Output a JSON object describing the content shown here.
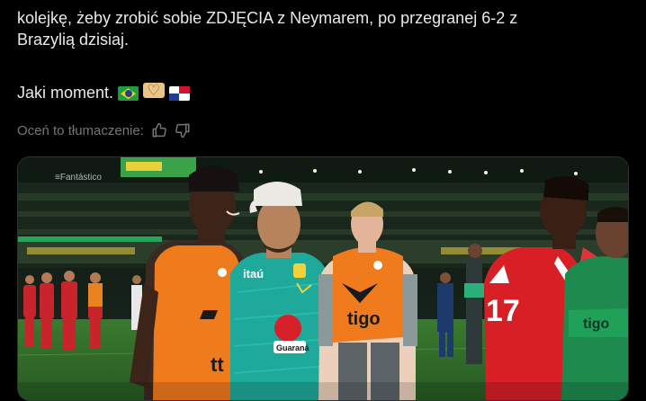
{
  "post": {
    "line1": "kolejkę, żeby zrobić sobie ZDJĘCIA z Neymarem, po przegranej 6-2 z",
    "line2": "Brazylią dzisiaj.",
    "line3": "Jaki moment.",
    "emojis": [
      "flag-brazil",
      "heart-hands",
      "flag-panama"
    ]
  },
  "translation_rating": {
    "label": "Oceń to tłumaczenie:",
    "thumbs_up_icon": "thumbs-up-icon",
    "thumbs_down_icon": "thumbs-down-icon"
  },
  "media": {
    "watermark": "≡Fantástico",
    "jersey_text_sponsor": "tigo",
    "jersey_text_itau": "itaú",
    "jersey_text_guarana": "Guaraná",
    "jersey_number": "17",
    "jersey_text_tt": "tt",
    "colors": {
      "orange_vest": "#f07b1d",
      "brazil_teal": "#1fa99a",
      "panama_red": "#d81f26",
      "pitch_green": "#2f6e2a",
      "stands": "#1a2a1e"
    }
  }
}
